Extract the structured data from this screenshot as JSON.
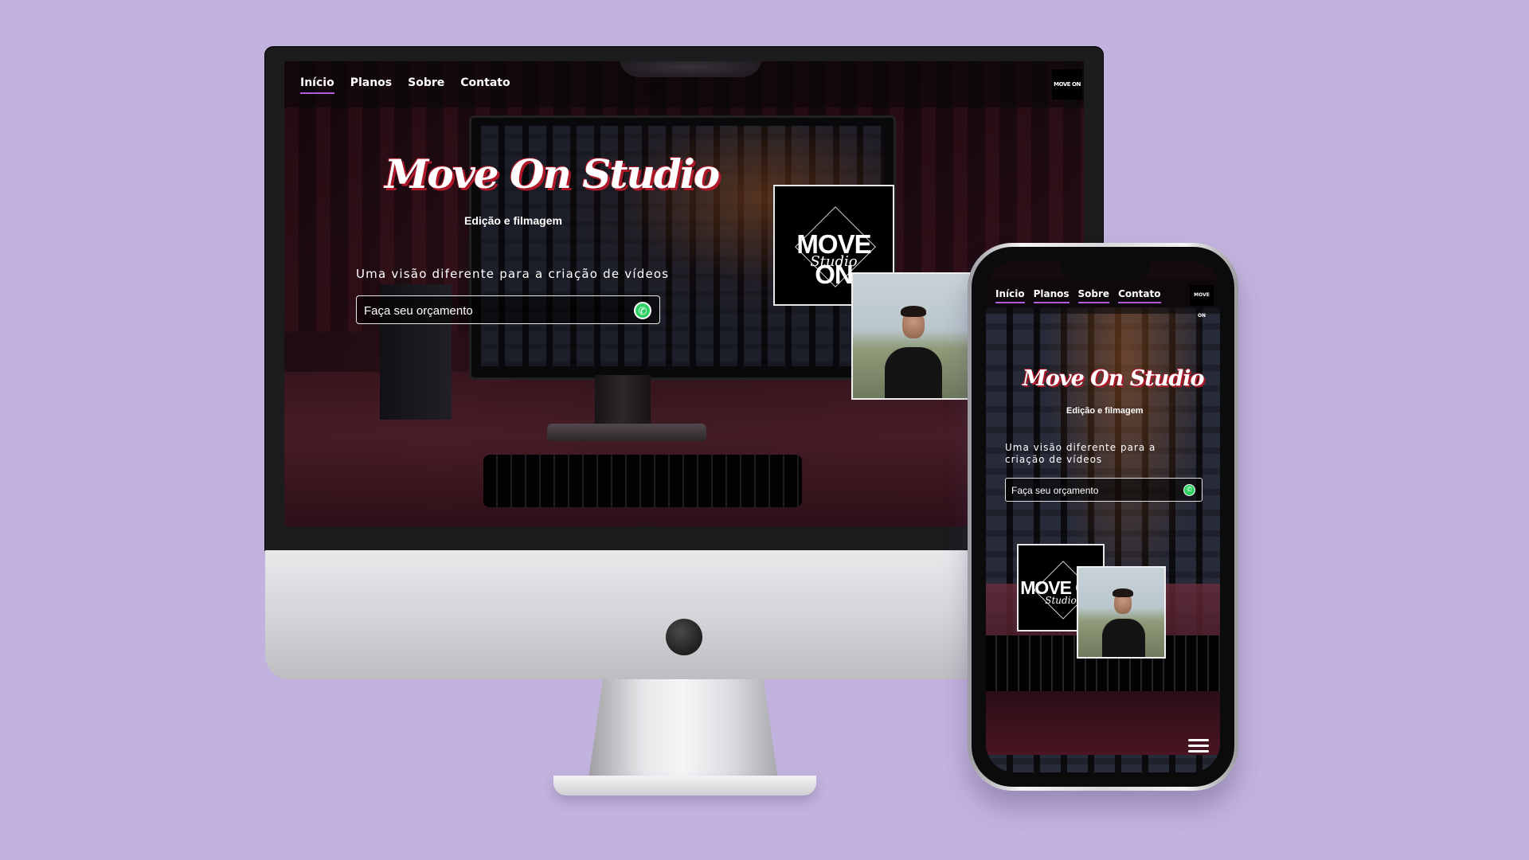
{
  "site": {
    "brand_title": "Move On Studio",
    "subtitle": "Edição e filmagem",
    "tagline": "Uma visão diferente para a criação de vídeos",
    "cta_label": "Faça seu orçamento",
    "logo_text": "MOVE ON",
    "logo_script": "Studio"
  },
  "nav": {
    "items": [
      {
        "label": "Início",
        "active": true
      },
      {
        "label": "Planos",
        "active": false
      },
      {
        "label": "Sobre",
        "active": false
      },
      {
        "label": "Contato",
        "active": false
      }
    ]
  },
  "colors": {
    "background": "#c1b3dd",
    "nav_underline": "#b25bd9",
    "title_shadow": "#b0182a",
    "whatsapp": "#2fd165"
  },
  "icons": {
    "whatsapp": "whatsapp-icon",
    "menu": "hamburger-menu-icon"
  }
}
